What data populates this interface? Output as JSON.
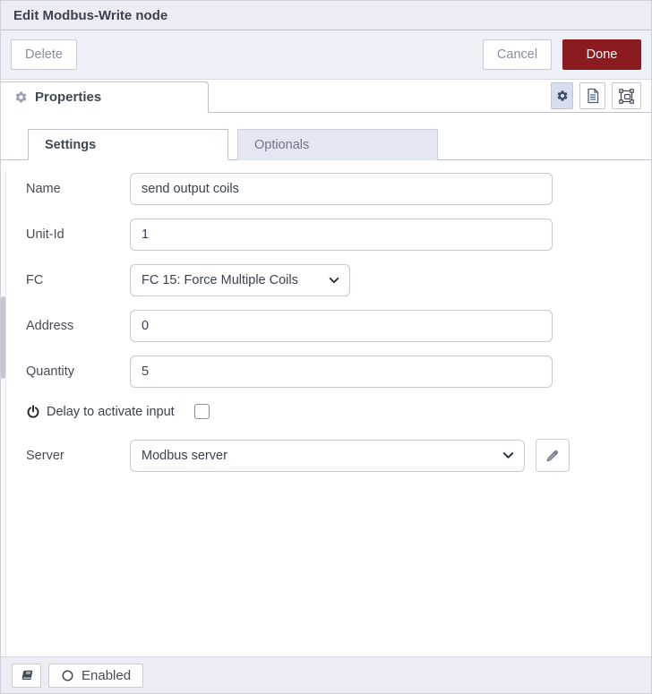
{
  "window": {
    "title": "Edit Modbus-Write node"
  },
  "toolbar": {
    "delete": "Delete",
    "cancel": "Cancel",
    "done": "Done"
  },
  "editor_tab": {
    "properties": "Properties"
  },
  "icons": {
    "properties_tab": "gear-icon",
    "node_settings_button": "gear-icon",
    "description_button": "document-icon",
    "appearance_button": "object-group-icon",
    "delay_option": "power-icon",
    "select_arrow": "chevron-down-icon",
    "server_edit_button": "pencil-icon",
    "library_button": "book-icon",
    "enabled_toggle": "circle-icon"
  },
  "sub_tabs": [
    {
      "label": "Settings",
      "active": true
    },
    {
      "label": "Optionals",
      "active": false
    }
  ],
  "form": {
    "name": {
      "label": "Name",
      "value": "send output coils"
    },
    "unit_id": {
      "label": "Unit-Id",
      "value": "1"
    },
    "fc": {
      "label": "FC",
      "value": "FC 15: Force Multiple Coils"
    },
    "address": {
      "label": "Address",
      "value": "0"
    },
    "quantity": {
      "label": "Quantity",
      "value": "5"
    },
    "delay": {
      "label": "Delay to activate input",
      "checked": false
    },
    "server": {
      "label": "Server",
      "value": "Modbus server"
    }
  },
  "footer": {
    "enabled": "Enabled"
  },
  "colors": {
    "done_button_bg": "#8C1B20",
    "header_bg": "#ECEDF4",
    "toolbar_bg": "#EEF0F7",
    "inactive_tab_bg": "#E3E7F3",
    "active_icon_button_bg": "#D9DDF0"
  }
}
